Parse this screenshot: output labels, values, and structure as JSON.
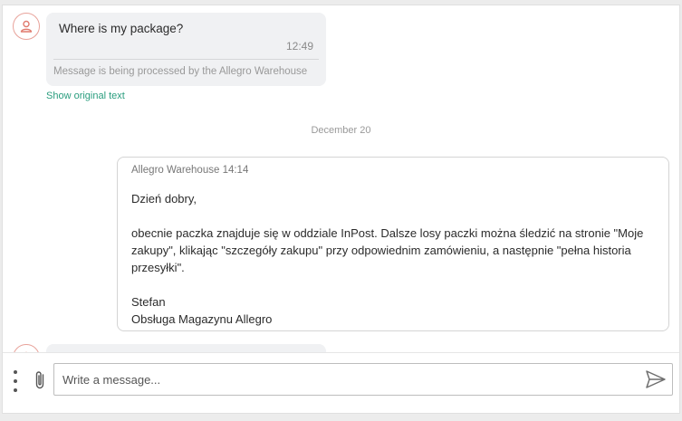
{
  "conversation": {
    "incoming_message": {
      "text": "Where is my package?",
      "time": "12:49",
      "processing_note": "Message is being processed by the Allegro Warehouse",
      "show_original_label": "Show original text"
    },
    "date_separator": "December 20",
    "reply": {
      "sender_meta": "Allegro Warehouse 14:14",
      "greeting": "Dzień dobry,",
      "body": "obecnie paczka znajduje się w oddziale InPost. Dalsze losy paczki można śledzić na stronie \"Moje zakupy\", klikając \"szczegóły zakupu\" przy odpowiednim zamówieniu, a następnie \"pełna historia przesyłki\".",
      "signature_name": "Stefan",
      "signature_team": "Obsługa Magazynu Allegro"
    }
  },
  "composer": {
    "placeholder": "Write a message...",
    "more_icon": "vertical-dots-icon",
    "attach_icon": "paperclip-icon",
    "send_icon": "send-icon"
  },
  "colors": {
    "accent_green": "#2a9d7e",
    "avatar_red": "#e8a29a",
    "bubble_gray": "#f0f1f3"
  }
}
